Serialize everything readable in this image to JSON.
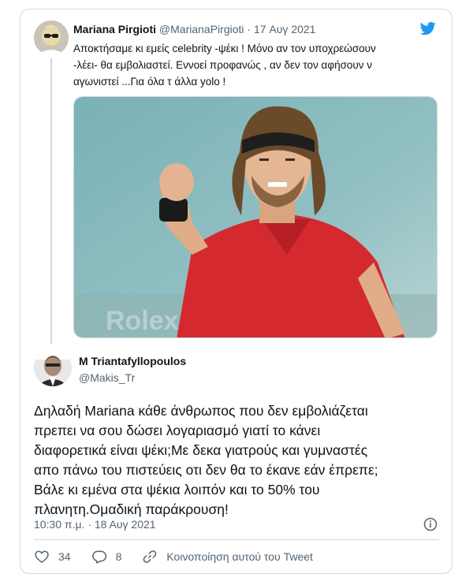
{
  "parent_tweet": {
    "author_name": "Mariana Pirgioti",
    "author_handle": "@MarianaPirgioti",
    "separator": " · ",
    "date": "17 Αυγ 2021",
    "text": "Αποκτήσαμε κι εμείς celebrity -ψέκι ! Μόνο αν τον υποχρεώσουν\n-λέει- θα εμβολιαστεί. Εννοεί προφανώς , αν δεν τον αφήσουν ν\nαγωνιστεί ...Για όλα τ άλλα yolo !",
    "media_icon": "tennis-player-photo"
  },
  "reply_tweet": {
    "author_name": "M Triantafyllopoulos",
    "author_handle": "@Makis_Tr",
    "text": "Δηλαδή Mariana κάθε άνθρωπος που δεν εμβολιάζεται\nπρεπει να σου δώσει λογαριασμό γιατί το κάνει\nδιαφορετικά είναι ψέκι;Με δεκα γιατρούς και γυμναστές\nαπο πάνω του πιστεύεις οτι δεν θα το έκανε εάν έπρεπε;\nΒάλε κι εμένα στα ψέκια λοιπόν και το 50% του\nπλανητη.Ομαδική παράκρουση!",
    "timestamp": "10:30 π.μ. · 18 Αυγ 2021"
  },
  "actions": {
    "like_count": "34",
    "reply_count": "8",
    "share_label": "Κοινοποίηση αυτού του Tweet"
  },
  "colors": {
    "twitter_blue": "#1d9bf0",
    "secondary_text": "#536471",
    "border": "#cfd9de",
    "shirt_red": "#d42a2f"
  }
}
